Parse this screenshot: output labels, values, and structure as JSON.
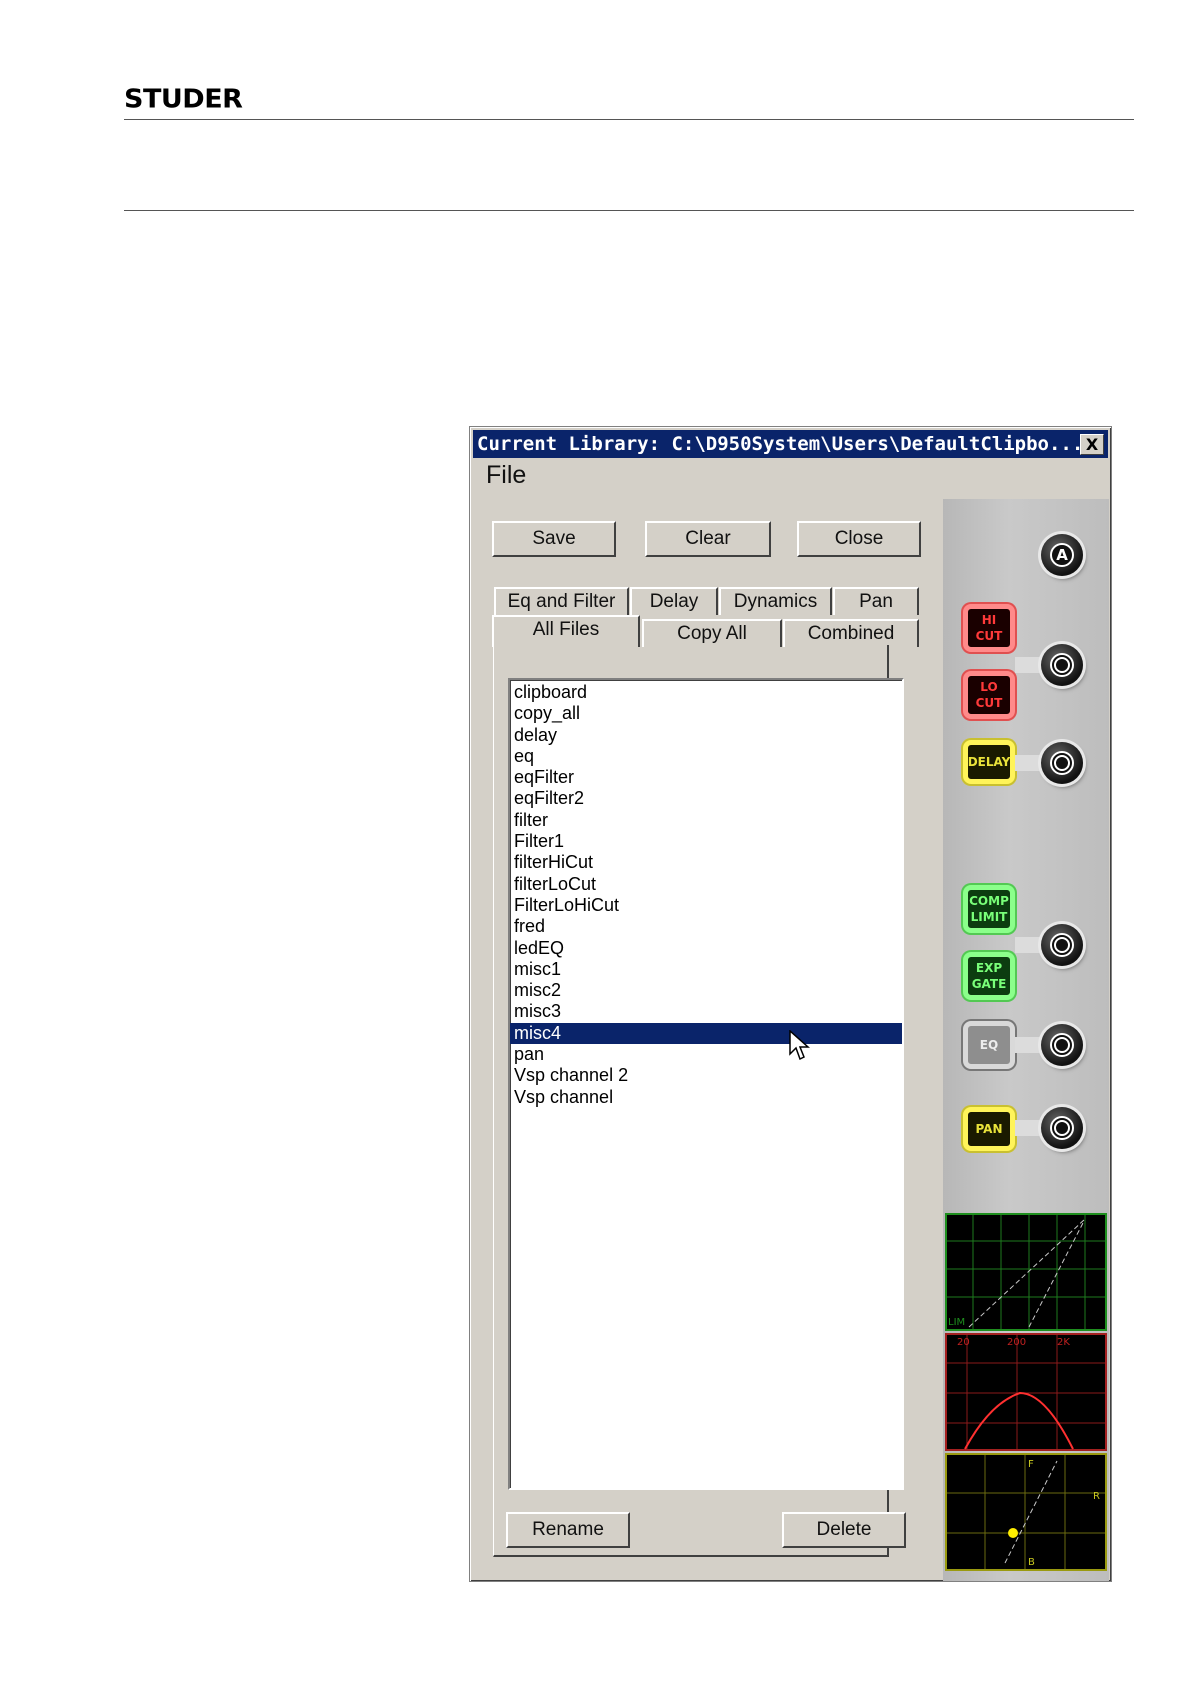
{
  "header": {
    "logo": "STUDER"
  },
  "window": {
    "title": "Current Library: C:\\D950System\\Users\\DefaultClipbo...",
    "close_glyph": "X",
    "menu": {
      "file": "File"
    },
    "buttons": {
      "save": "Save",
      "clear": "Clear",
      "close": "Close",
      "rename": "Rename",
      "delete": "Delete"
    },
    "tabs_row1": [
      "Eq and Filter",
      "Delay",
      "Dynamics",
      "Pan"
    ],
    "tabs_row2": [
      "All Files",
      "Copy All",
      "Combined"
    ],
    "active_tab": "All Files",
    "files": [
      "clipboard",
      "copy_all",
      "delay",
      "eq",
      "eqFilter",
      "eqFilter2",
      "filter",
      "Filter1",
      "filterHiCut",
      "filterLoCut",
      "FilterLoHiCut",
      "fred",
      "ledEQ",
      "misc1",
      "misc2",
      "misc3",
      "misc4",
      "pan",
      "Vsp channel 2",
      "Vsp channel"
    ],
    "selected_file": "misc4"
  },
  "strip": {
    "knob_a": "A",
    "modules": {
      "hi_cut": [
        "HI",
        "CUT"
      ],
      "lo_cut": [
        "LO",
        "CUT"
      ],
      "delay": [
        "DELAY"
      ],
      "comp_limit": [
        "COMP",
        "LIMIT"
      ],
      "exp_gate": [
        "EXP",
        "GATE"
      ],
      "eq": [
        "EQ"
      ],
      "pan": [
        "PAN"
      ]
    },
    "scopes": {
      "dyn_label": "LIM",
      "eq_ticks": [
        "20",
        "200",
        "2K"
      ],
      "pan_labels": [
        "F",
        "R",
        "B"
      ]
    }
  },
  "colors": {
    "title_bg": "#0a246a",
    "face": "#d4d0c8",
    "red_accent": "#ff3a3a",
    "yellow_accent": "#e9e23a",
    "green_accent": "#79ff79"
  }
}
